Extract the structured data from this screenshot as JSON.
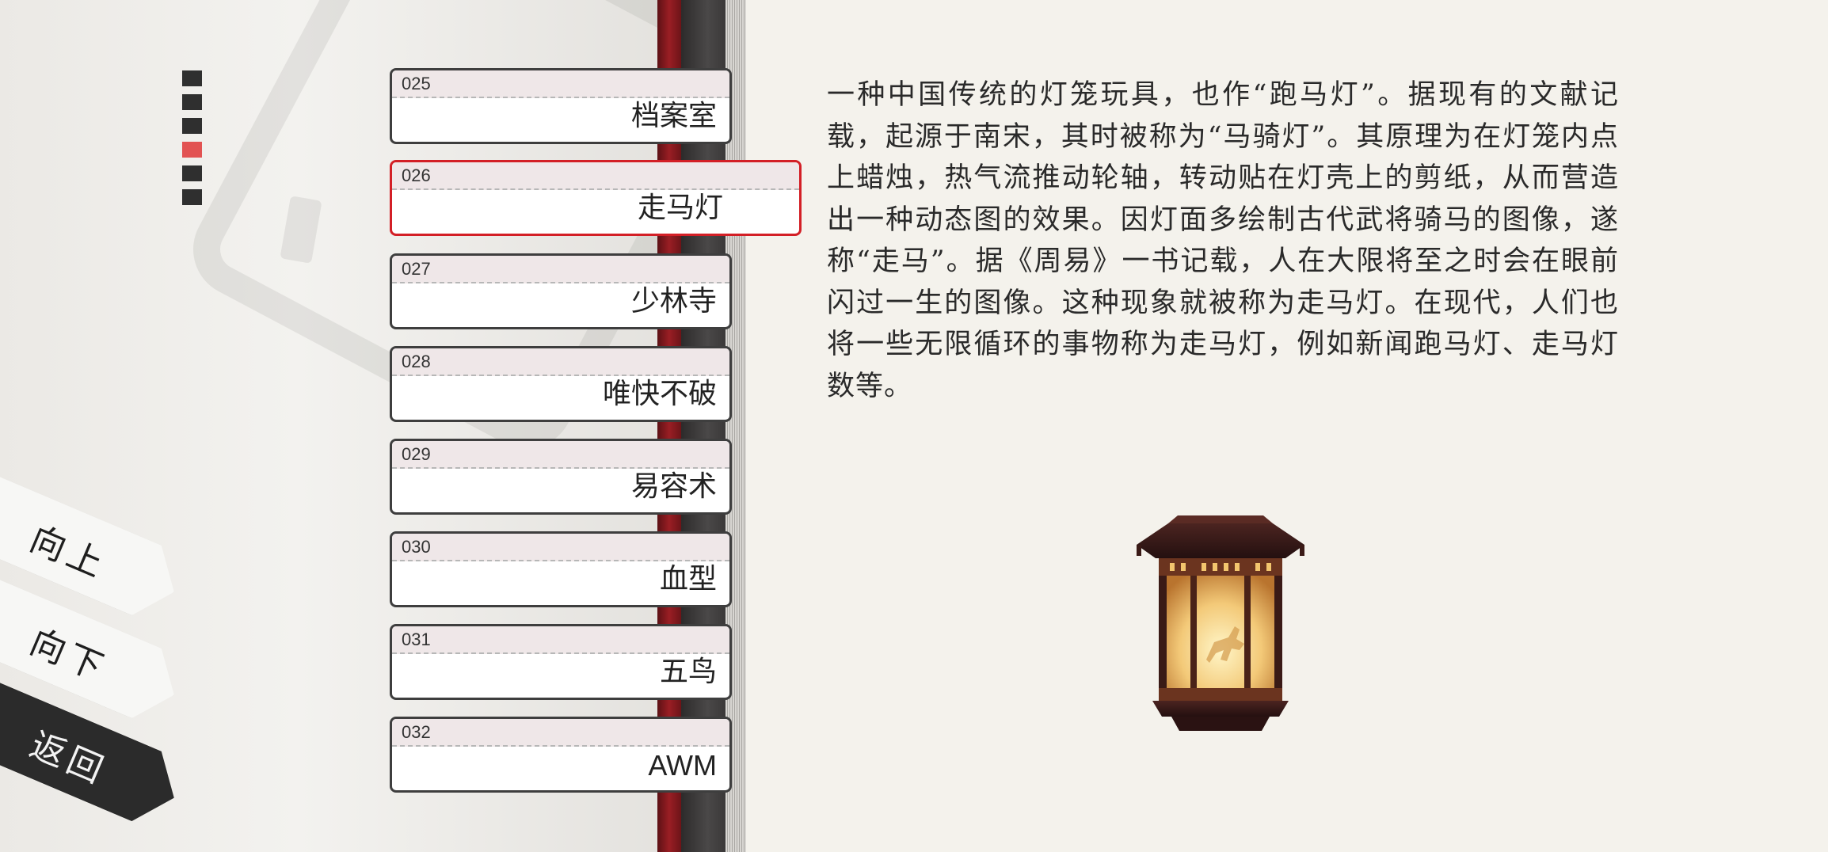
{
  "entries": [
    {
      "num": "025",
      "title": "档案室",
      "selected": false
    },
    {
      "num": "026",
      "title": "走马灯",
      "selected": true
    },
    {
      "num": "027",
      "title": "少林寺",
      "selected": false
    },
    {
      "num": "028",
      "title": "唯快不破",
      "selected": false
    },
    {
      "num": "029",
      "title": "易容术",
      "selected": false
    },
    {
      "num": "030",
      "title": "血型",
      "selected": false
    },
    {
      "num": "031",
      "title": "五鸟",
      "selected": false
    },
    {
      "num": "032",
      "title": "AWM",
      "selected": false
    }
  ],
  "nav": {
    "up_label": "向上",
    "down_label": "向下",
    "back_label": "返回"
  },
  "page_indicator": {
    "total": 6,
    "active_index": 3
  },
  "description": "一种中国传统的灯笼玩具，也作“跑马灯”。据现有的文献记载，起源于南宋，其时被称为“马骑灯”。其原理为在灯笼内点上蜡烛，热气流推动轮轴，转动贴在灯壳上的剪纸，从而营造出一种动态图的效果。因灯面多绘制古代武将骑马的图像，遂称“走马”。据《周易》一书记载，人在大限将至之时会在眼前闪过一生的图像。这种现象就被称为走马灯。在现代，人们也将一些无限循环的事物称为走马灯，例如新闻跑马灯、走马灯数等。",
  "illustration": "lantern-icon",
  "colors": {
    "accent": "#d31f26",
    "indicator_active": "#e25252",
    "indicator_inactive": "#2f2f2f",
    "spine_red": "#9a1e24"
  }
}
